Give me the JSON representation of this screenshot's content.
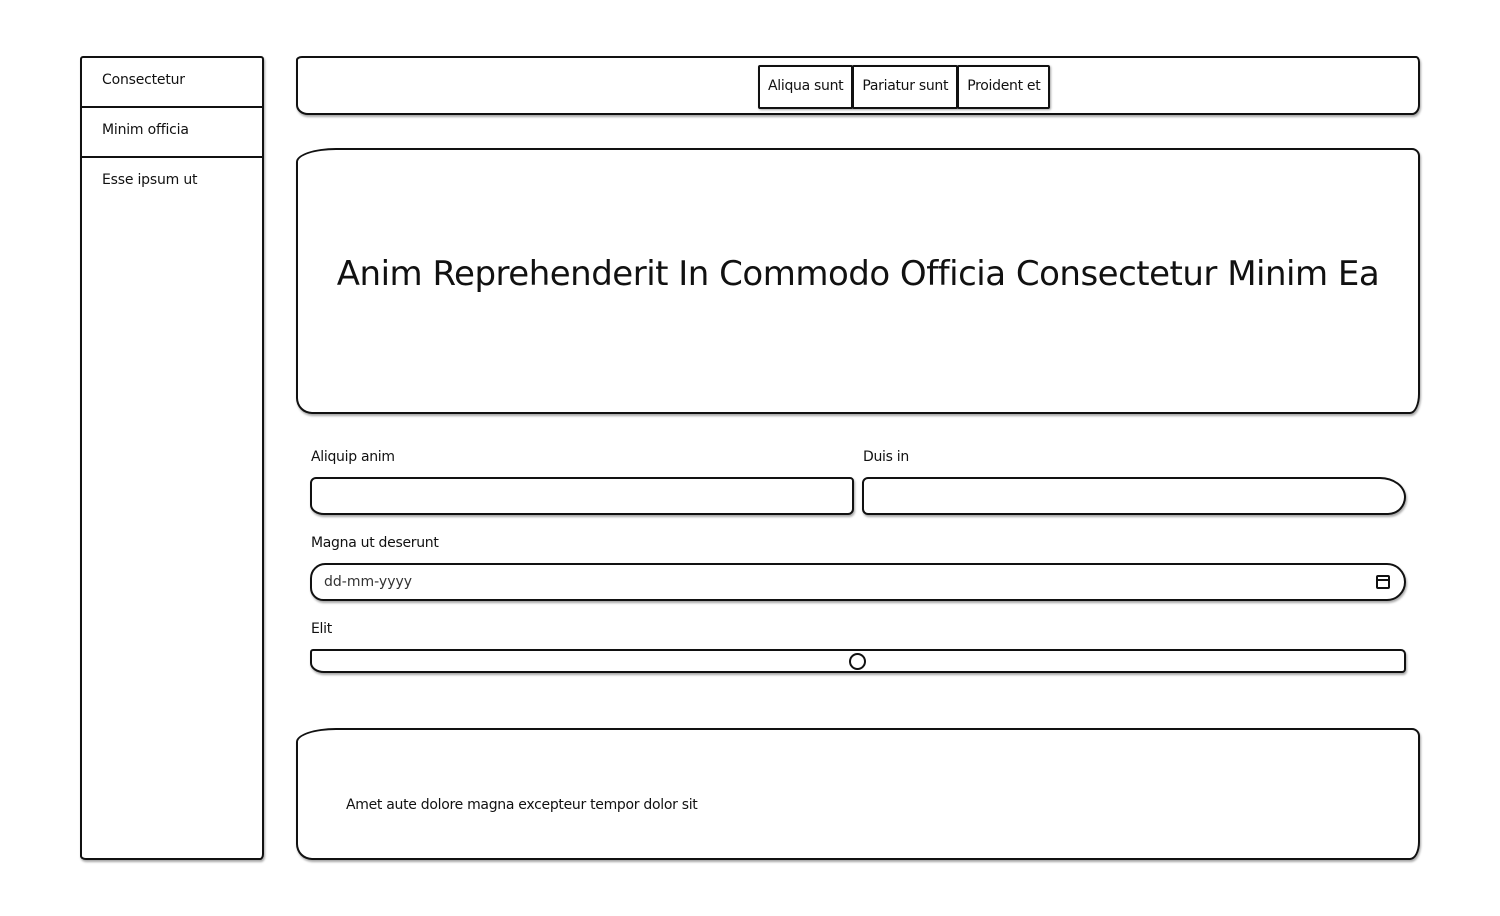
{
  "sidebar": {
    "items": [
      {
        "label": "Consectetur"
      },
      {
        "label": "Minim officia"
      },
      {
        "label": "Esse ipsum ut"
      }
    ]
  },
  "navbar": {
    "tabs": [
      {
        "label": "Aliqua sunt"
      },
      {
        "label": "Pariatur sunt"
      },
      {
        "label": "Proident et"
      }
    ]
  },
  "hero": {
    "title": "Anim Reprehenderit In Commodo Officia Consectetur Minim Ea"
  },
  "form": {
    "field1": {
      "label": "Aliquip anim",
      "value": ""
    },
    "field2": {
      "label": "Duis in",
      "value": ""
    },
    "date": {
      "label": "Magna ut deserunt",
      "placeholder": "dd-mm-yyyy",
      "icon": "calendar-icon"
    },
    "slider": {
      "label": "Elit",
      "value": 0.5
    }
  },
  "footer": {
    "text": "Amet aute dolore magna excepteur tempor dolor sit"
  }
}
